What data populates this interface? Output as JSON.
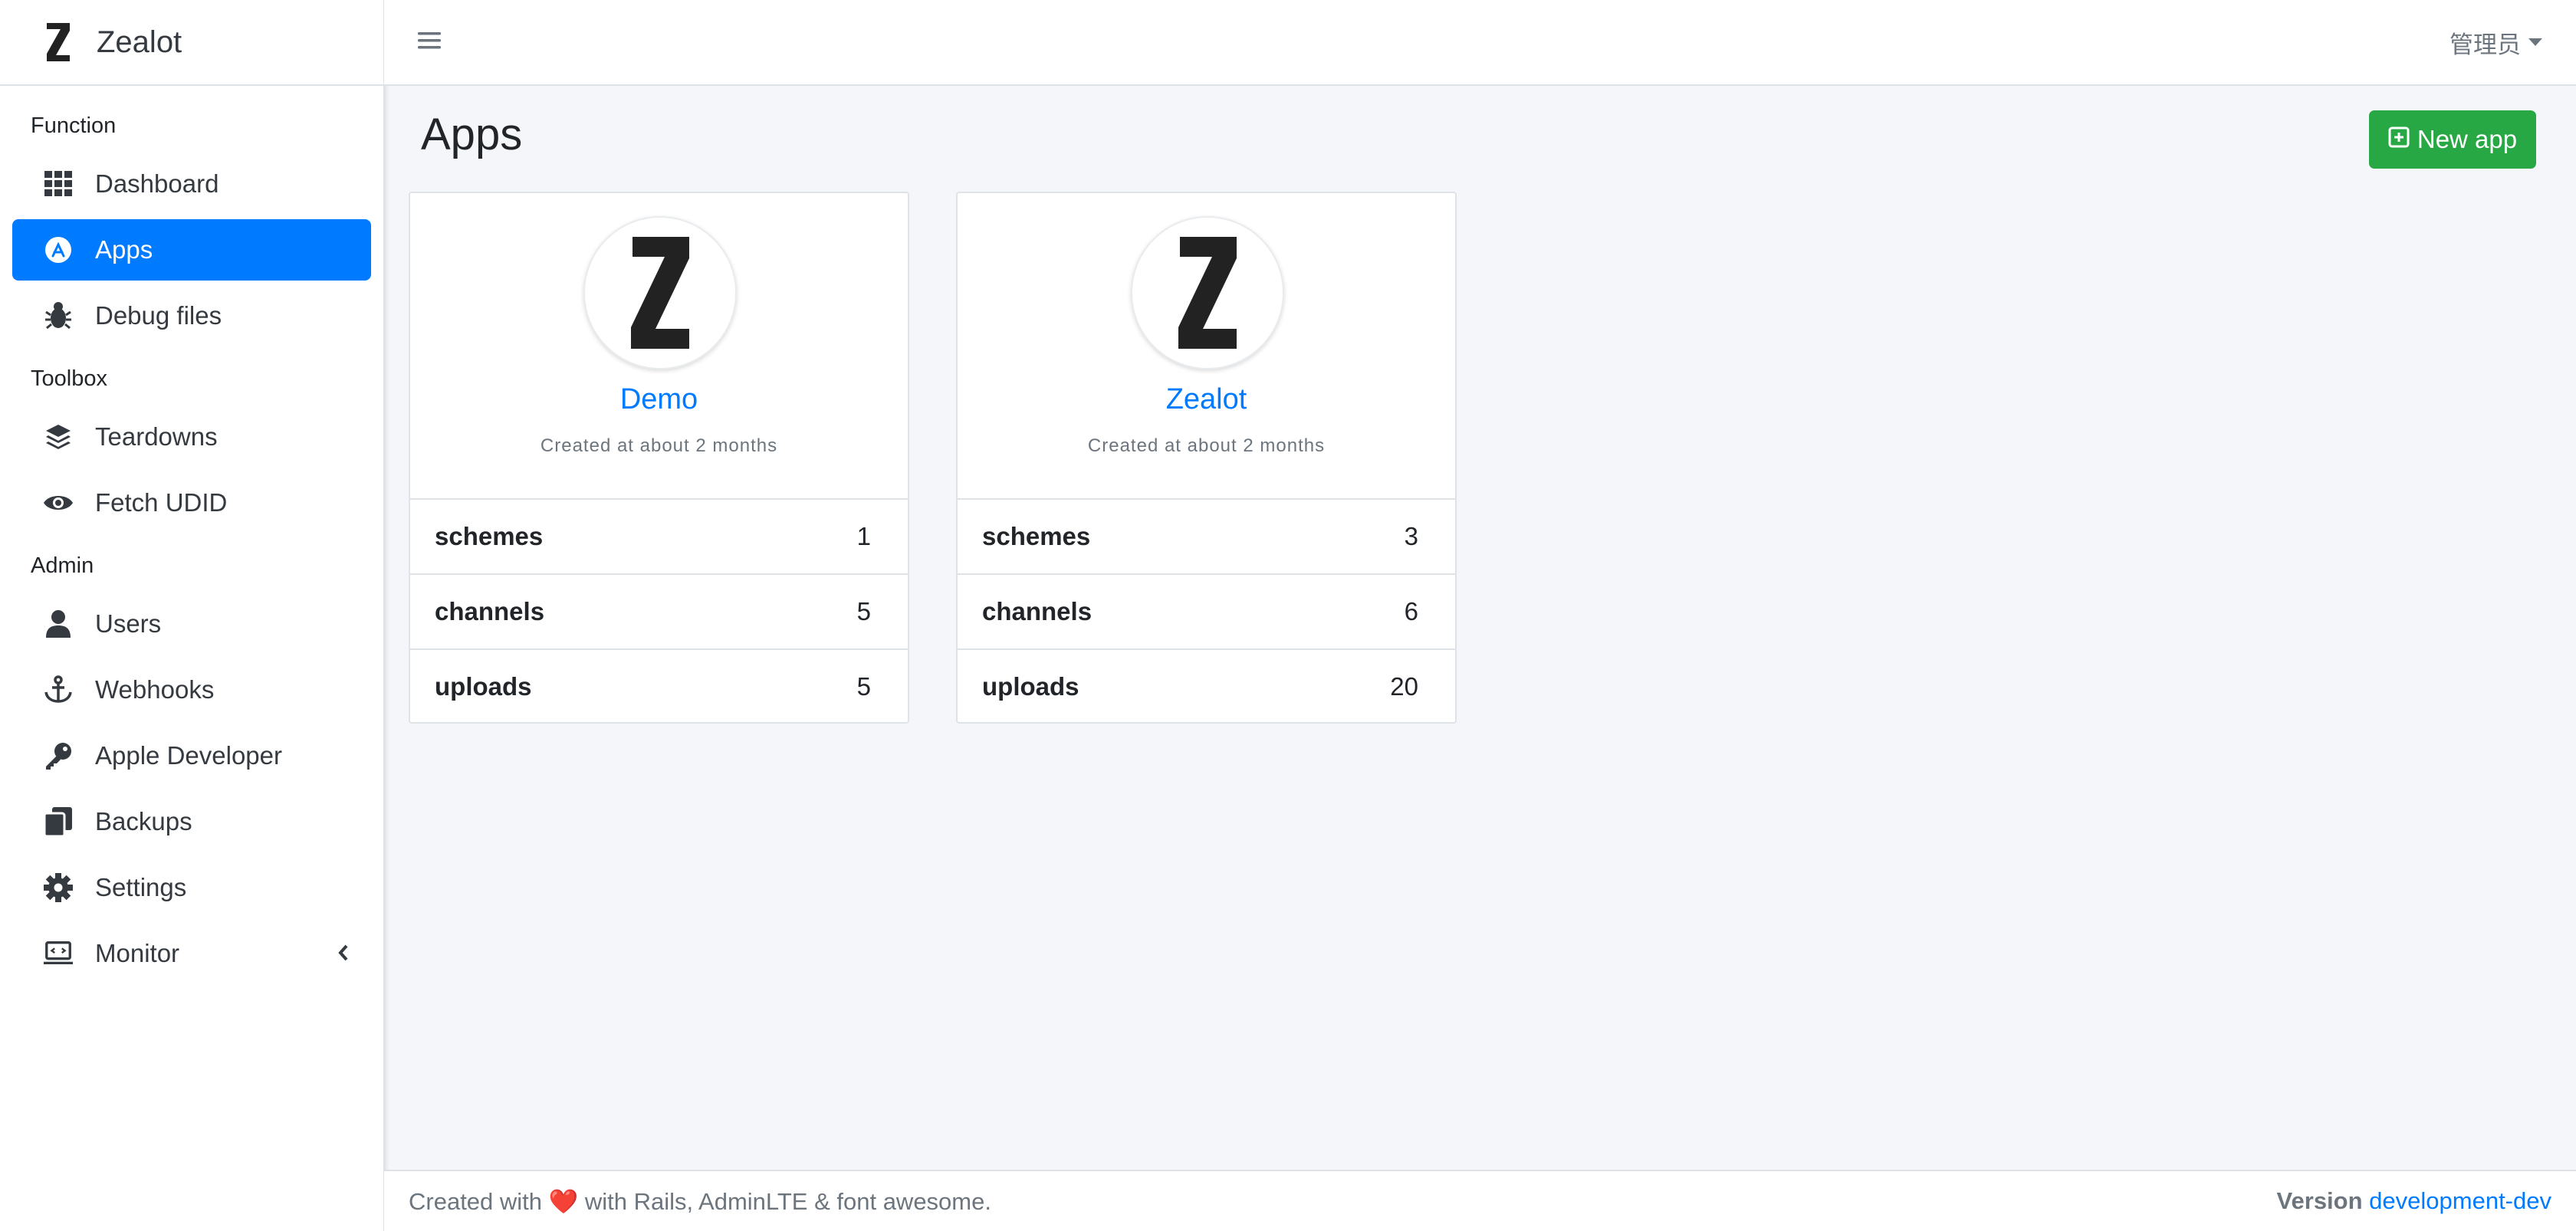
{
  "brand": {
    "name": "Zealot"
  },
  "sidebar": {
    "sections": [
      {
        "header": "Function",
        "items": [
          {
            "label": "Dashboard",
            "icon": "grid-icon",
            "active": false
          },
          {
            "label": "Apps",
            "icon": "app-store-icon",
            "active": true
          },
          {
            "label": "Debug files",
            "icon": "bug-icon",
            "active": false
          }
        ]
      },
      {
        "header": "Toolbox",
        "items": [
          {
            "label": "Teardowns",
            "icon": "layers-icon",
            "active": false
          },
          {
            "label": "Fetch UDID",
            "icon": "eye-icon",
            "active": false
          }
        ]
      },
      {
        "header": "Admin",
        "items": [
          {
            "label": "Users",
            "icon": "user-icon",
            "active": false
          },
          {
            "label": "Webhooks",
            "icon": "anchor-icon",
            "active": false
          },
          {
            "label": "Apple Developer",
            "icon": "key-icon",
            "active": false
          },
          {
            "label": "Backups",
            "icon": "copy-icon",
            "active": false
          },
          {
            "label": "Settings",
            "icon": "gear-icon",
            "active": false
          },
          {
            "label": "Monitor",
            "icon": "laptop-code-icon",
            "active": false
          }
        ]
      }
    ]
  },
  "topbar": {
    "user": "管理员"
  },
  "main": {
    "title": "Apps",
    "new_app_label": "New app",
    "apps": [
      {
        "name": "Demo",
        "meta": "Created at about 2 months",
        "stats": [
          {
            "label": "schemes",
            "value": "1"
          },
          {
            "label": "channels",
            "value": "5"
          },
          {
            "label": "uploads",
            "value": "5"
          }
        ]
      },
      {
        "name": "Zealot",
        "meta": "Created at about 2 months",
        "stats": [
          {
            "label": "schemes",
            "value": "3"
          },
          {
            "label": "channels",
            "value": "6"
          },
          {
            "label": "uploads",
            "value": "20"
          }
        ]
      }
    ]
  },
  "footer": {
    "prefix": "Created with",
    "heart": "❤️",
    "suffix": "with Rails, AdminLTE & font awesome.",
    "version_label": "Version",
    "version_value": "development-dev"
  },
  "colors": {
    "primary": "#007bff",
    "success": "#28a745",
    "background": "#f4f6f9"
  }
}
